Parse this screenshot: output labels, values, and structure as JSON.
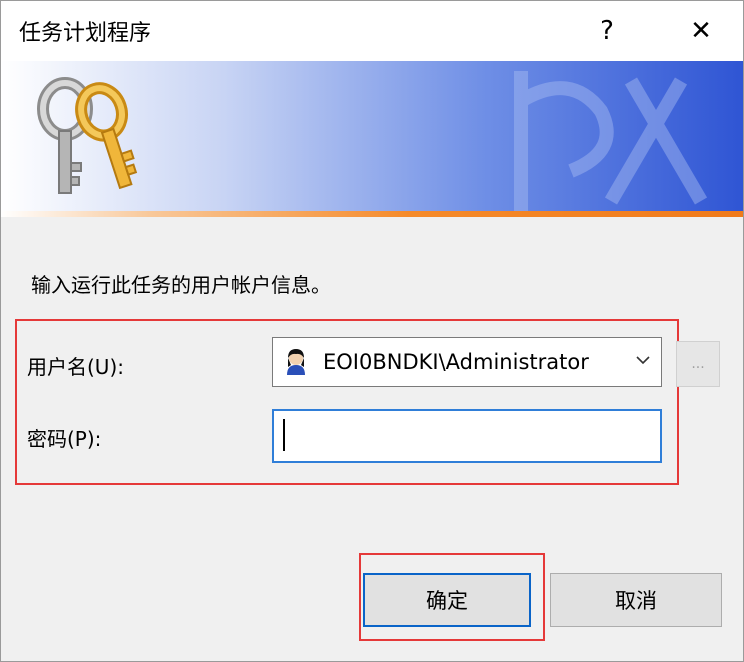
{
  "window": {
    "title": "任务计划程序",
    "help_glyph": "?",
    "close_glyph": "✕"
  },
  "banner": {
    "left_icon": "keys-icon",
    "watermark": "key-watermark"
  },
  "prompt": "输入运行此任务的用户帐户信息。",
  "fields": {
    "user_label": "用户名(U):",
    "user_value": "EOI0BNDKI\\Administrator",
    "user_icon": "user-avatar-icon",
    "browse_label": "...",
    "password_label": "密码(P):",
    "password_value": ""
  },
  "buttons": {
    "ok_label": "确定",
    "cancel_label": "取消"
  },
  "colors": {
    "highlight": "#e53939",
    "focus": "#2f7ed8",
    "default_button_border": "#0a64c8",
    "banner_orange": "#f58a2a",
    "banner_blue": "#2f55d4"
  }
}
